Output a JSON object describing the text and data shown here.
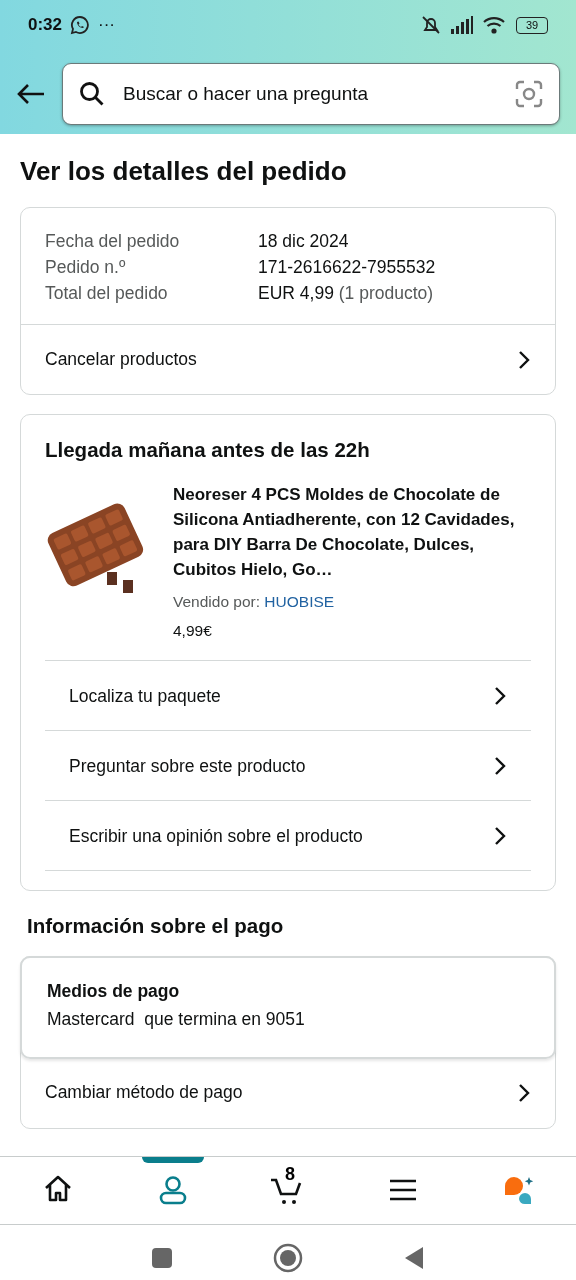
{
  "status_bar": {
    "time": "0:32",
    "notifications": "···",
    "battery": "39"
  },
  "search": {
    "placeholder": "Buscar o hacer una pregunta"
  },
  "page_title": "Ver los detalles del pedido",
  "order_summary": {
    "rows": [
      {
        "label": "Fecha del pedido",
        "value": "18 dic 2024",
        "note": ""
      },
      {
        "label": "Pedido n.º",
        "value": "171-2616622-7955532",
        "note": ""
      },
      {
        "label": "Total del pedido",
        "value": "EUR 4,99",
        "note": "(1 producto)"
      }
    ],
    "action": "Cancelar productos"
  },
  "shipment": {
    "heading": "Llegada mañana antes de las 22h",
    "product": {
      "title": "Neoreser 4 PCS Moldes de Chocolate de Silicona Antiadherente, con 12 Cavidades, para DIY Barra De Chocolate, Dulces, Cubitos Hielo, Go…",
      "seller_label": "Vendido por:",
      "seller": "HUOBISE",
      "price": "4,99€"
    },
    "actions": [
      "Localiza tu paquete",
      "Preguntar sobre este producto",
      "Escribir una opinión sobre el producto"
    ]
  },
  "payment": {
    "heading": "Información sobre el pago",
    "method_label": "Medios de pago",
    "method": "Mastercard  que termina en 9051",
    "action": "Cambiar método de pago"
  },
  "bottom_nav": [
    {
      "kind": "home",
      "selected": false
    },
    {
      "kind": "account",
      "selected": true
    },
    {
      "kind": "cart",
      "selected": false,
      "count": "8"
    },
    {
      "kind": "menu",
      "selected": false
    },
    {
      "kind": "assistant",
      "selected": false
    }
  ]
}
